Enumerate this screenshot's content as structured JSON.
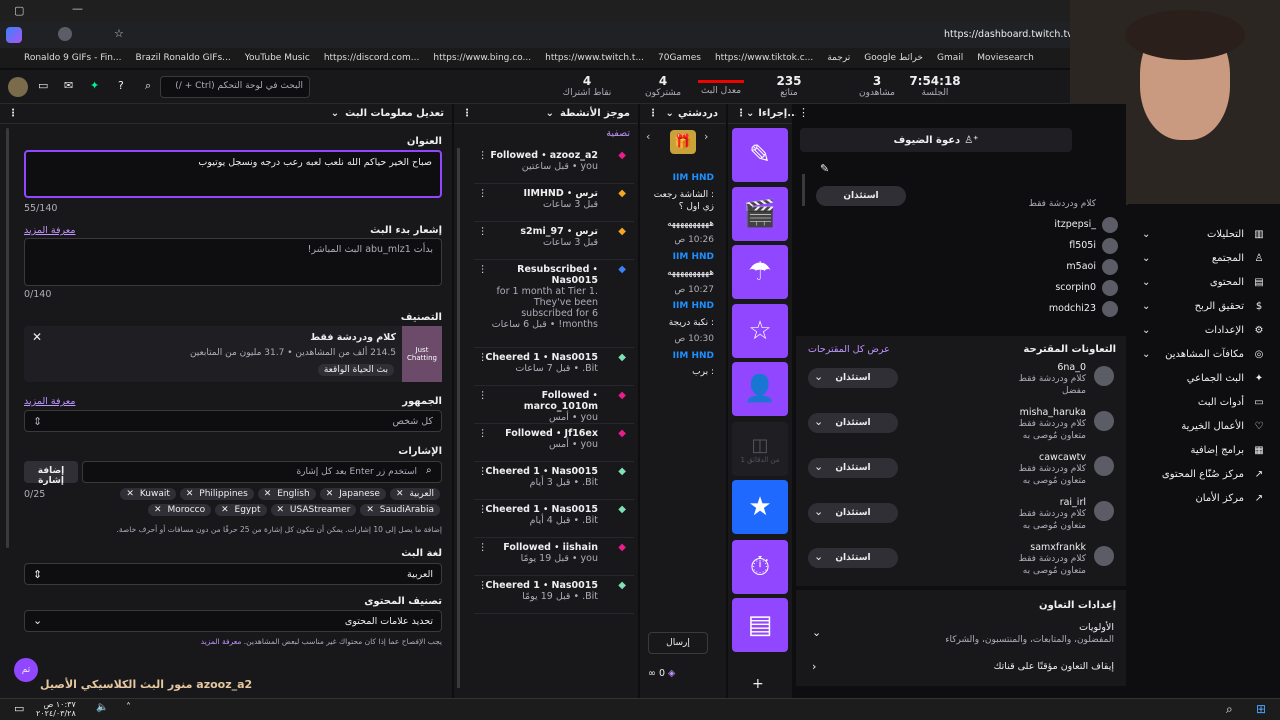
{
  "browser": {
    "url": "https://dashboard.twitch.tv/u/",
    "bookmarks": [
      "Ronaldo 9 GIFs - Fin...",
      "Brazil Ronaldo GIFs...",
      "YouTube Music",
      "https://discord.com...",
      "https://www.bing.co...",
      "https://www.twitch.t...",
      "70Games",
      "https://www.tiktok.c...",
      "ترجمة",
      "Google خرائط",
      "Gmail",
      "Moviesearch"
    ]
  },
  "topbar": {
    "search_placeholder": "البحث في لوحة التحكم (Ctrl + /)",
    "stats": [
      {
        "value": "4",
        "label": "نقاط اشتراك"
      },
      {
        "value": "4",
        "label": "مشتركون"
      },
      {
        "value": "",
        "label": "معدل البث"
      },
      {
        "value": "235",
        "label": "متابَع"
      },
      {
        "value": "3",
        "label": "مشاهدون"
      },
      {
        "value": "7:54:18",
        "label": "الجلسة"
      }
    ]
  },
  "edit_panel": {
    "header": "تعديل معلومات البث",
    "title_label": "العنوان",
    "title_value": "صباح الخير حياكم الله نلعب لعبه رعب درجه ونسجل يوتيوب",
    "title_count": "55/140",
    "notif_label": "إشعار بدء البث",
    "learn_more": "معرفة المزيد",
    "notif_value": "بدأت abu_mlz1 البث المباشر!",
    "notif_count": "0/140",
    "category_label": "التصنيف",
    "category_name": "كلام ودردشة فقط",
    "category_stats": "214.5 ألف من المشاهدين • 31.7 مليون من المتابعين",
    "category_tag": "بث الحياة الواقعة",
    "category_thumb": "Just Chatting",
    "audience_label": "الجمهور",
    "audience_value": "كل شخص",
    "tags_label": "الإشارات",
    "tags_placeholder": "استخدم زر Enter بعد كل إشارة",
    "add_tag": "إضافة إشارة",
    "tags_count": "0/25",
    "tags": [
      "العربية",
      "Japanese",
      "English",
      "Philippines",
      "Kuwait",
      "SaudiArabia",
      "USAStreamer",
      "Egypt",
      "Morocco"
    ],
    "tags_hint": "إضافة ما يصل إلى 10 إشارات. يمكن أن تتكون كل إشارة من 25 حرفًا من دون مسافات أو أحرف خاصة.",
    "lang_label": "لغة البث",
    "lang_value": "العربية",
    "content_label": "تصنيف المحتوى",
    "content_value": "تحديد علامات المحتوى",
    "content_hint": "يجب الإفصاح عما إذا كان محتواك غير مناسب لبعض المشاهدين.",
    "content_link": "معرفة المزيد",
    "now_playing": "منور البث الكلاسيكي الأصيل azooz_a2",
    "avatar_letter": "تم"
  },
  "activity": {
    "header": "موجز الأنشطة",
    "filter": "تصفية",
    "items": [
      {
        "user": "azooz_a2",
        "type": "Followed",
        "time": "you • قبل ساعتين",
        "color": "#e91e8c"
      },
      {
        "user": "IIMHND",
        "type": "ترس",
        "time": "قبل 3 ساعات",
        "color": "#f5a623"
      },
      {
        "user": "s2mi_97",
        "type": "ترس",
        "time": "قبل 3 ساعات",
        "color": "#f5a623"
      },
      {
        "user": "Nas0015",
        "type": "Resubscribed",
        "time": "for 1 month at Tier 1. They've been subscribed for 6 months! • قبل 6 ساعات",
        "color": "#3b82f6"
      },
      {
        "user": "Nas0015",
        "type": "Cheered 1",
        "time": "Bit. • قبل 7 ساعات",
        "color": "#7ee0b5"
      },
      {
        "user": "marco_1010m",
        "type": "Followed",
        "time": "you • أمس",
        "color": "#e91e8c"
      },
      {
        "user": "Jf16ex",
        "type": "Followed",
        "time": "you • أمس",
        "color": "#e91e8c"
      },
      {
        "user": "Nas0015",
        "type": "Cheered 1",
        "time": "Bit. • قبل 3 أيام",
        "color": "#7ee0b5"
      },
      {
        "user": "Nas0015",
        "type": "Cheered 1",
        "time": "Bit. • قبل 4 أيام",
        "color": "#7ee0b5"
      },
      {
        "user": "iishain",
        "type": "Followed",
        "time": "you • قبل 19 يومًا",
        "color": "#e91e8c"
      },
      {
        "user": "Nas0015",
        "type": "Cheered 1",
        "time": "Bit. • قبل 19 يومًا",
        "color": "#7ee0b5"
      }
    ]
  },
  "chat": {
    "header": "دردشتي",
    "send": "إرسال",
    "messages": [
      "IIM HND",
      ": الشاشة رجعت زي اول ؟",
      "ههههههههههه",
      "10:26 ص",
      "IIM HND",
      "ههههههههههه",
      "10:27 ص",
      "IIM HND",
      ": نكبة دريجة",
      "10:30 ص",
      "IIM HND",
      ": برب"
    ],
    "points": "0"
  },
  "quick_actions": {
    "header": "إجراءا...",
    "disabled_text": "1 من الدقائق"
  },
  "guests": {
    "invite": "دعوة الضيوف",
    "raid_button": "استئذان",
    "list": [
      "itzpepsi_",
      "fl505i",
      "m5aoi",
      "scorpin0",
      "modchi23"
    ],
    "list_sub": "كلام ودردشة فقط"
  },
  "collabs": {
    "title": "التعاونات المقترحة",
    "view_all": "عرض كل المقترحات",
    "button": "استئذان",
    "items": [
      {
        "name": "6na_0",
        "cat": "كلام ودردشة فقط",
        "note": "مفضل"
      },
      {
        "name": "misha_haruka",
        "cat": "كلام ودردشة فقط",
        "note": "متعاون مُوصى به"
      },
      {
        "name": "cawcawtv",
        "cat": "كلام ودردشة فقط",
        "note": "متعاون مُوصى به"
      },
      {
        "name": "rai_irl",
        "cat": "كلام ودردشة فقط",
        "note": "متعاون مُوصى به"
      },
      {
        "name": "samxfrankk",
        "cat": "كلام ودردشة فقط",
        "note": "متعاون مُوصى به"
      }
    ],
    "settings_title": "إعدادات التعاون",
    "priorities": "الأولويات",
    "priorities_sub": "المفضلون، والمتابعات، والمنتسبون، والشركاء",
    "pause": "إيقاف التعاون مؤقتًا على قناتك"
  },
  "sidebar": {
    "items": [
      {
        "label": "التحليلات",
        "icon": "analytics-icon",
        "glyph": "▥"
      },
      {
        "label": "المجتمع",
        "icon": "community-icon",
        "glyph": "♙"
      },
      {
        "label": "المحتوى",
        "icon": "content-icon",
        "glyph": "▤"
      },
      {
        "label": "تحقيق الربح",
        "icon": "monetization-icon",
        "glyph": "$"
      },
      {
        "label": "الإعدادات",
        "icon": "settings-icon",
        "glyph": "⚙"
      },
      {
        "label": "مكافآت المشاهدين",
        "icon": "rewards-icon",
        "glyph": "◎"
      },
      {
        "label": "البث الجماعي",
        "icon": "stream-together-icon",
        "glyph": "✦"
      },
      {
        "label": "أدوات البث",
        "icon": "stream-tools-icon",
        "glyph": "▭"
      },
      {
        "label": "الأعمال الخيرية",
        "icon": "charity-icon",
        "glyph": "♡"
      },
      {
        "label": "برامج إضافية",
        "icon": "extensions-icon",
        "glyph": "▦"
      },
      {
        "label": "مركز صُنّاع المحتوى",
        "icon": "creator-camp-icon",
        "glyph": "↗"
      },
      {
        "label": "مركز الأمان",
        "icon": "safety-center-icon",
        "glyph": "↗"
      }
    ]
  },
  "taskbar": {
    "time": "١٠:٣٧ ص",
    "date": "٢٠٢٤/٠٣/٢٨"
  }
}
